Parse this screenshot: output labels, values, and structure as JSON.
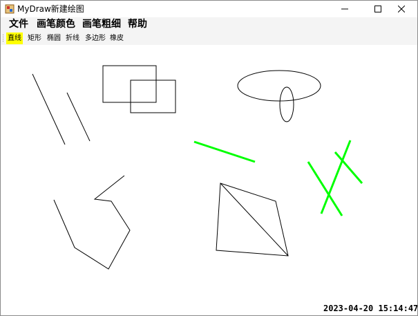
{
  "window": {
    "title": "MyDraw新建绘图",
    "app_icon": "paint-app-icon",
    "controls": [
      "minimize-icon",
      "maximize-icon",
      "close-icon"
    ]
  },
  "menu": {
    "items": [
      "文件",
      "画笔颜色",
      "画笔粗细",
      "帮助"
    ]
  },
  "toolbar": {
    "tools": [
      "直线",
      "矩形",
      "椭圆",
      "折线",
      "多边形",
      "橡皮"
    ],
    "active_tool": "直线",
    "active_color": "#ffff00"
  },
  "canvas": {
    "thin_stroke_color": "#000000",
    "thick_stroke_color": "#00ff00"
  },
  "status": {
    "datetime": "2023-04-20 15:14:47"
  }
}
